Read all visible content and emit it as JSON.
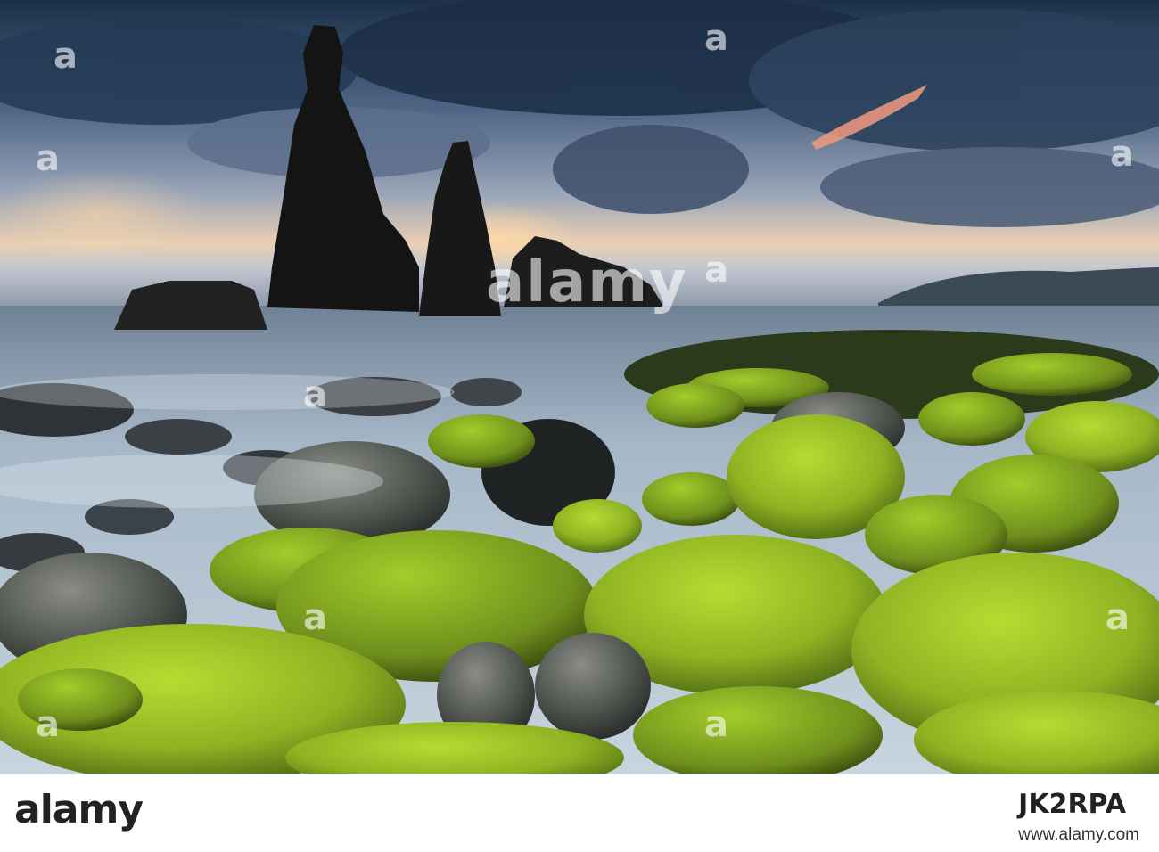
{
  "photo": {
    "description_colors": {
      "sky_top": "#1f3550",
      "sky_mid": "#5b6f8e",
      "sunset": "#f2c9a0",
      "sea": "#9fb3c4",
      "moss": "#9bc22a",
      "rock": "#1a1a1a"
    }
  },
  "watermark": {
    "main": "alamy",
    "small": "a"
  },
  "footer": {
    "logo": "alamy",
    "image_id": "JK2RPA",
    "url": "www.alamy.com"
  }
}
